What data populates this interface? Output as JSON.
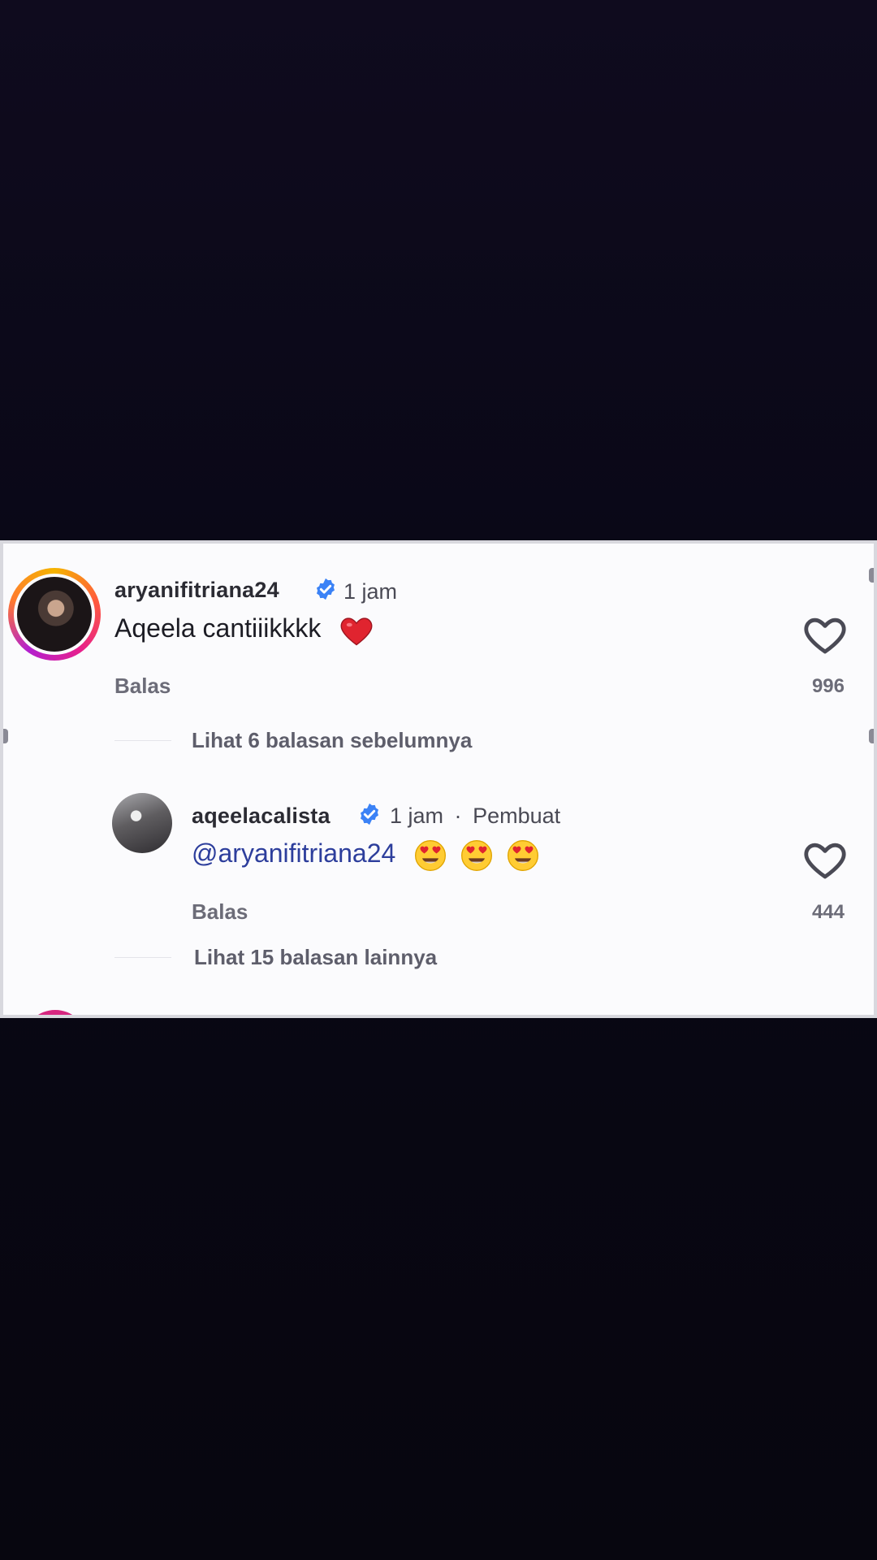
{
  "comments": [
    {
      "username": "aryanifitriana24",
      "verified": true,
      "time": "1 jam",
      "text": "Aqeela cantiiikkkk",
      "emoji": "red-heart",
      "reply_label": "Balas",
      "like_count": "996",
      "view_prev_replies": "Lihat 6 balasan sebelumnya"
    },
    {
      "username": "aqeelacalista",
      "verified": true,
      "time": "1 jam",
      "creator_label": "Pembuat",
      "separator": "·",
      "mention": "@aryanifitriana24",
      "emojis": [
        "heart-eyes",
        "heart-eyes",
        "heart-eyes"
      ],
      "reply_label": "Balas",
      "like_count": "444",
      "view_more_replies": "Lihat 15 balasan lainnya"
    }
  ],
  "colors": {
    "verified_badge": "#3b82f6",
    "mention": "#2d3e9c",
    "heart": "#e0242f",
    "story_ring": "#e7208c"
  }
}
